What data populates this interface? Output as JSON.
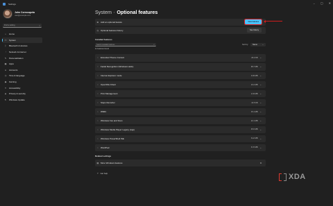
{
  "window": {
    "title": "Settings"
  },
  "profile": {
    "name": "John Corrocapeta",
    "email": "user@example.com"
  },
  "search": {
    "placeholder": "Find a setting"
  },
  "sidebar": {
    "items": [
      {
        "label": "Home",
        "icon": "home-icon",
        "glyph": "⌂"
      },
      {
        "label": "System",
        "icon": "monitor-icon",
        "glyph": "▭"
      },
      {
        "label": "Bluetooth & devices",
        "icon": "bluetooth-icon",
        "glyph": "ᛒ"
      },
      {
        "label": "Network & internet",
        "icon": "wifi-icon",
        "glyph": "◔"
      },
      {
        "label": "Personalization",
        "icon": "brush-icon",
        "glyph": "✎"
      },
      {
        "label": "Apps",
        "icon": "apps-icon",
        "glyph": "▦"
      },
      {
        "label": "Accounts",
        "icon": "person-icon",
        "glyph": "●"
      },
      {
        "label": "Time & language",
        "icon": "clock-icon",
        "glyph": "◷"
      },
      {
        "label": "Gaming",
        "icon": "gamepad-icon",
        "glyph": "◉"
      },
      {
        "label": "Accessibility",
        "icon": "accessibility-icon",
        "glyph": "✦"
      },
      {
        "label": "Privacy & security",
        "icon": "shield-icon",
        "glyph": "◈"
      },
      {
        "label": "Windows Update",
        "icon": "update-icon",
        "glyph": "↻"
      }
    ]
  },
  "breadcrumb": {
    "parent": "System",
    "separator": "›",
    "current": "Optional features"
  },
  "top_cards": {
    "add": {
      "label": "Add an optional feature",
      "button": "View features"
    },
    "history": {
      "label": "Optional features history",
      "button": "See history"
    }
  },
  "installed": {
    "title": "Installed features",
    "find_placeholder": "Search installed features",
    "sort_label": "Sort by:",
    "sort_value": "Name",
    "found": "11 features found",
    "features": [
      {
        "name": "Extended Theme Content",
        "size": "26.2 KB"
      },
      {
        "name": "Facial Recognition (Windows Hello)",
        "size": "95.7 MB"
      },
      {
        "name": "Internet Explorer mode",
        "size": "3.03 MB"
      },
      {
        "name": "OpenSSH Client",
        "size": "10.2 MB"
      },
      {
        "name": "Print Management",
        "size": "2.43 MB"
      },
      {
        "name": "Steps Recorder",
        "size": "16.5 KB"
      },
      {
        "name": "WMIC",
        "size": "15.1 MB"
      },
      {
        "name": "Windows Fax and Scan",
        "size": "22.1 MB"
      },
      {
        "name": "Windows Media Player Legacy (App)",
        "size": "45.6 MB"
      },
      {
        "name": "Windows PowerShell ISE",
        "size": "6.12 MB"
      },
      {
        "name": "WordPad",
        "size": "6.72 MB"
      }
    ]
  },
  "related": {
    "title": "Related settings",
    "more_label": "More Windows features"
  },
  "help": {
    "label": "Get help"
  },
  "watermark": {
    "text": "XDA"
  },
  "colors": {
    "accent": "#4cc2ff",
    "annotation": "#d11c1c",
    "background": "#202020",
    "card": "#2b2b2b"
  }
}
